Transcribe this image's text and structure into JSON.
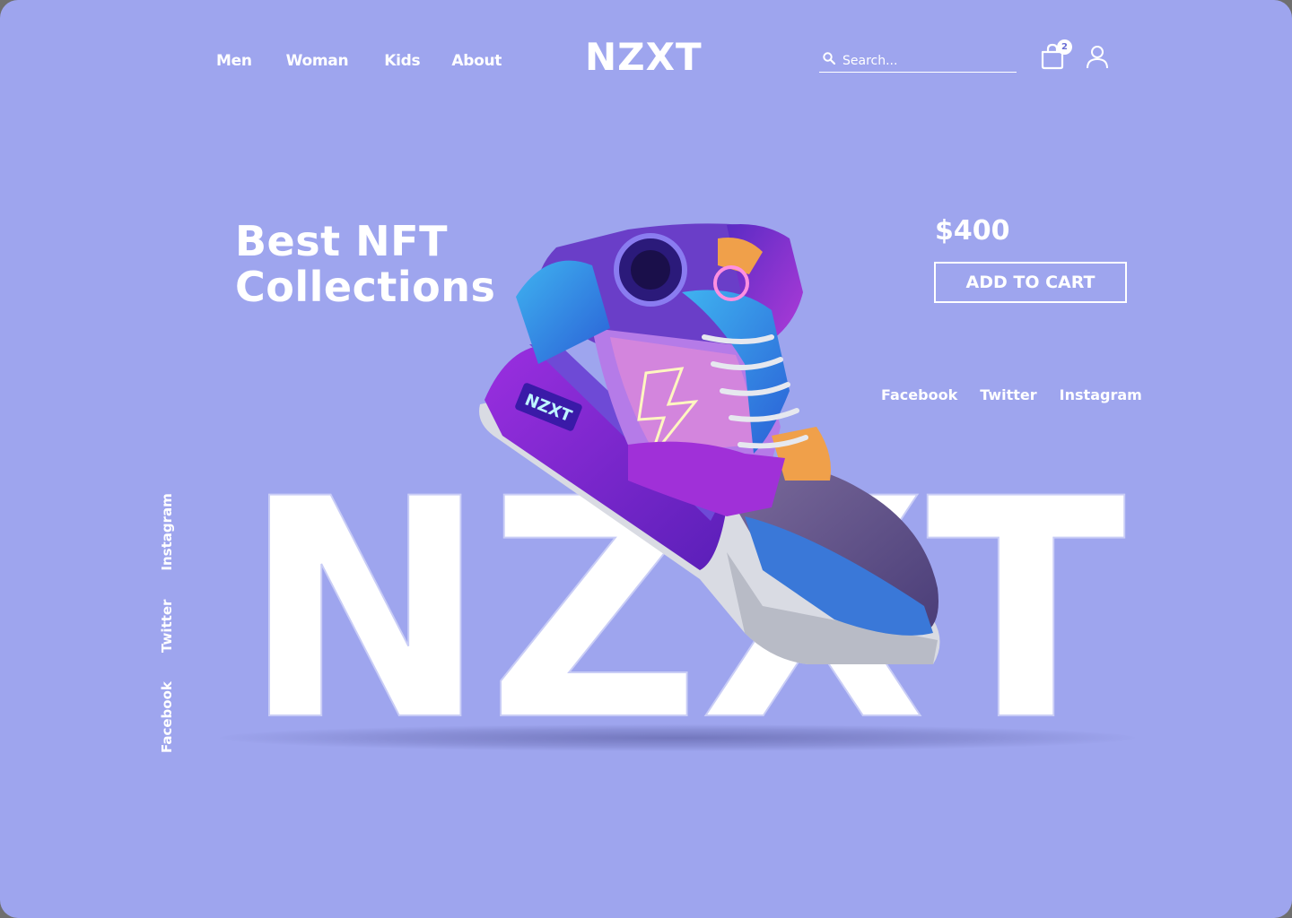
{
  "nav": {
    "items": [
      {
        "label": "Men"
      },
      {
        "label": "Woman"
      },
      {
        "label": "Kids"
      },
      {
        "label": "About"
      }
    ]
  },
  "brand": {
    "logo_text": "NZXT"
  },
  "search": {
    "placeholder": "Search..."
  },
  "cart": {
    "count": "2",
    "icon": "shopping-bag-icon"
  },
  "user": {
    "icon": "user-icon"
  },
  "hero": {
    "headline_line1": "Best NFT",
    "headline_line2": "Collections",
    "price": "$400",
    "add_to_cart_label": "ADD TO CART",
    "wordmark": "NZXT"
  },
  "social_horizontal": [
    {
      "label": "Facebook"
    },
    {
      "label": "Twitter"
    },
    {
      "label": "Instagram"
    }
  ],
  "social_vertical": [
    {
      "label": "Facebook"
    },
    {
      "label": "Twitter"
    },
    {
      "label": "Instagram"
    }
  ],
  "product": {
    "image": "nft-sneaker",
    "shoe_label": "NZXT"
  },
  "colors": {
    "background": "#9ea5ee",
    "text": "#ffffff",
    "shoe_primary": "#8a2be2",
    "shoe_secondary": "#3b8fe6"
  }
}
